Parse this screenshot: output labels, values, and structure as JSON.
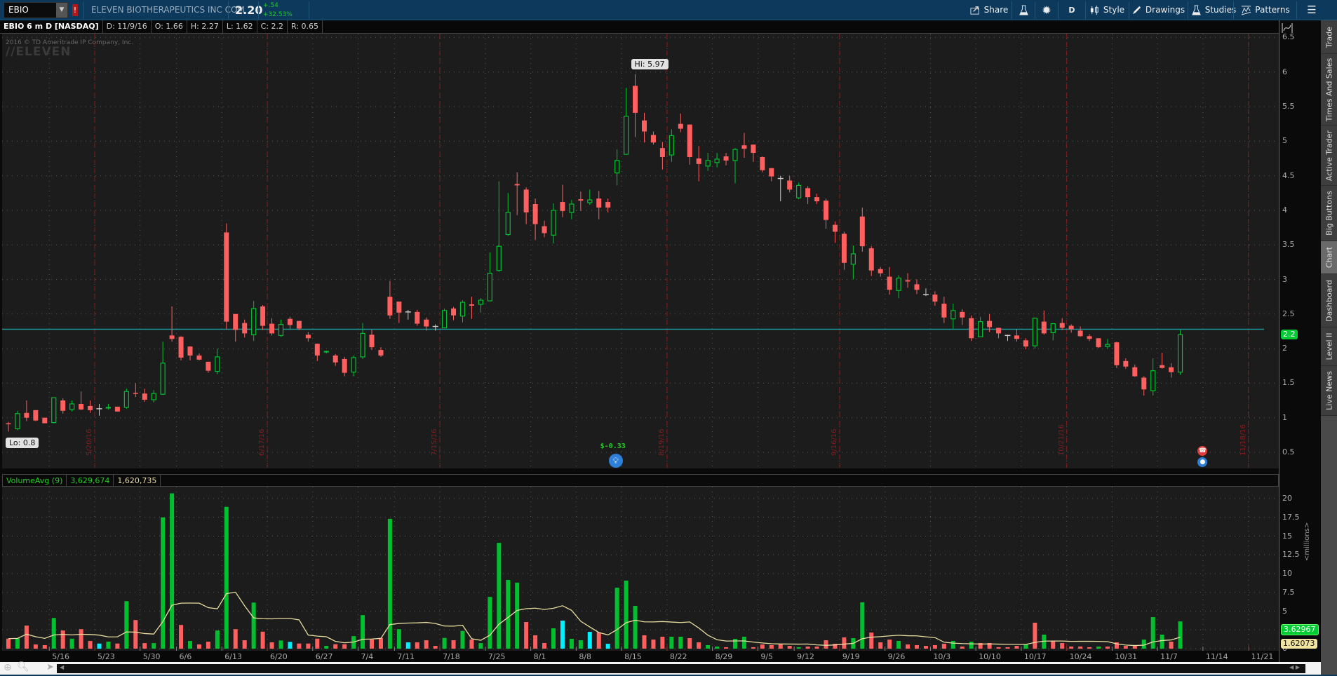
{
  "header": {
    "symbol": "EBIO",
    "alert_badge": "!",
    "company": "ELEVEN BIOTHERAPEUTICS INC COM",
    "last": "2.20",
    "change": "+.54",
    "change_pct": "+32.53%",
    "buttons": {
      "share": "Share",
      "aggregation": "D",
      "style": "Style",
      "drawings": "Drawings",
      "studies": "Studies",
      "patterns": "Patterns"
    }
  },
  "info": {
    "title": "EBIO 6 m D [NASDAQ]",
    "date": "D: 11/9/16",
    "open": "O: 1.66",
    "high": "H: 2.27",
    "low": "L: 1.62",
    "close": "C: 2.2",
    "range": "R: 0.65"
  },
  "watermark": {
    "copyright": "2016 © TD Ameritrade IP Company, Inc.",
    "logo": "ELEVEN"
  },
  "volume_header": {
    "study": "VolumeAvg (9)",
    "volume": "3,629,674",
    "avg": "1,620,735"
  },
  "side_tabs": [
    "Trade",
    "Times And Sales",
    "Active Trader",
    "Big Buttons",
    "Chart",
    "Dashboard",
    "Level II",
    "Live News"
  ],
  "active_tab": "Chart",
  "annotations": {
    "hi": "Hi: 5.97",
    "lo": "Lo: 0.8",
    "earnings": "$-0.33",
    "last_tag": "2.2",
    "vol_tag": "3.62967",
    "avg_tag": "1.62073",
    "vol_unit": "<millions>"
  },
  "colors": {
    "up": "#00c030",
    "down": "#ff5f5f",
    "neutral": "#c8c8c8",
    "cyan": "#00f0ff",
    "avg": "#e8dca0",
    "hline": "#1a9c9c",
    "event": "#8b1a1a"
  },
  "chart_data": {
    "type": "candlestick",
    "symbol": "EBIO",
    "period": "6 m",
    "aggregation": "D",
    "price_axis": {
      "ticks": [
        "0.5",
        "1",
        "1.5",
        "2",
        "2.5",
        "3",
        "3.5",
        "4",
        "4.5",
        "5",
        "5.5",
        "6",
        "6.5"
      ],
      "range": [
        0.5,
        6.5
      ]
    },
    "volume_axis": {
      "ticks": [
        "0",
        "2.5",
        "5",
        "7.5",
        "10",
        "12.5",
        "15",
        "17.5",
        "20"
      ],
      "range": [
        0,
        20
      ],
      "unit": "millions"
    },
    "horizontal_line": 2.28,
    "x_labels": [
      {
        "label": "5/16",
        "index": 5
      },
      {
        "label": "5/23",
        "index": 10
      },
      {
        "label": "5/30",
        "index": 15
      },
      {
        "label": "6/6",
        "index": 19
      },
      {
        "label": "6/13",
        "index": 24
      },
      {
        "label": "6/20",
        "index": 29
      },
      {
        "label": "6/27",
        "index": 34
      },
      {
        "label": "7/4",
        "index": 39
      },
      {
        "label": "7/11",
        "index": 43
      },
      {
        "label": "7/18",
        "index": 48
      },
      {
        "label": "7/25",
        "index": 53
      },
      {
        "label": "8/1",
        "index": 58
      },
      {
        "label": "8/8",
        "index": 63
      },
      {
        "label": "8/15",
        "index": 68
      },
      {
        "label": "8/22",
        "index": 73
      },
      {
        "label": "8/29",
        "index": 78
      },
      {
        "label": "9/5",
        "index": 83
      },
      {
        "label": "9/12",
        "index": 87
      },
      {
        "label": "9/19",
        "index": 92
      },
      {
        "label": "9/26",
        "index": 97
      },
      {
        "label": "10/3",
        "index": 102
      },
      {
        "label": "10/10",
        "index": 107
      },
      {
        "label": "10/17",
        "index": 112
      },
      {
        "label": "10/24",
        "index": 117
      },
      {
        "label": "10/31",
        "index": 122
      },
      {
        "label": "11/7",
        "index": 127
      },
      {
        "label": "11/14",
        "index": 132
      },
      {
        "label": "11/21",
        "index": 137
      }
    ],
    "events": [
      {
        "label": "5/20/16",
        "after_index": 9
      },
      {
        "label": "6/17/16",
        "after_index": 28
      },
      {
        "label": "7/15/16",
        "after_index": 47
      },
      {
        "label": "8/19/16",
        "after_index": 72
      },
      {
        "label": "9/16/16",
        "after_index": 91
      },
      {
        "label": "10/21/16",
        "after_index": 116
      },
      {
        "label": "11/18/16",
        "after_index": 136
      }
    ],
    "hi_index": 69,
    "lo_index": 0,
    "earnings_index": 67,
    "icons_index": 132,
    "ohlc": [
      [
        0.92,
        0.94,
        0.8,
        0.91
      ],
      [
        0.84,
        1.1,
        0.82,
        1.06
      ],
      [
        1.07,
        1.25,
        0.95,
        1.0
      ],
      [
        1.11,
        1.11,
        0.95,
        0.96
      ],
      [
        1.0,
        1.0,
        0.92,
        0.92
      ],
      [
        0.93,
        1.29,
        0.92,
        1.29
      ],
      [
        1.25,
        1.28,
        1.06,
        1.1
      ],
      [
        1.12,
        1.25,
        1.09,
        1.2
      ],
      [
        1.2,
        1.38,
        1.11,
        1.12
      ],
      [
        1.17,
        1.25,
        1.07,
        1.11
      ],
      [
        1.13,
        1.2,
        1.03,
        1.13
      ],
      [
        1.14,
        1.2,
        1.12,
        1.15
      ],
      [
        1.16,
        1.16,
        1.09,
        1.09
      ],
      [
        1.15,
        1.42,
        1.13,
        1.38
      ],
      [
        1.36,
        1.5,
        1.3,
        1.35
      ],
      [
        1.35,
        1.42,
        1.23,
        1.26
      ],
      [
        1.26,
        1.4,
        1.22,
        1.35
      ],
      [
        1.34,
        2.1,
        1.34,
        1.79
      ],
      [
        2.19,
        2.61,
        2.1,
        2.14
      ],
      [
        2.17,
        2.18,
        1.83,
        1.87
      ],
      [
        2.03,
        2.03,
        1.83,
        1.9
      ],
      [
        1.9,
        1.93,
        1.83,
        1.84
      ],
      [
        1.81,
        1.81,
        1.65,
        1.68
      ],
      [
        1.67,
        2.0,
        1.63,
        1.88
      ],
      [
        3.68,
        3.81,
        2.28,
        2.39
      ],
      [
        2.5,
        2.5,
        2.1,
        2.27
      ],
      [
        2.37,
        2.42,
        2.16,
        2.22
      ],
      [
        2.2,
        2.69,
        2.11,
        2.58
      ],
      [
        2.61,
        2.63,
        2.27,
        2.33
      ],
      [
        2.36,
        2.44,
        2.19,
        2.22
      ],
      [
        2.19,
        2.42,
        2.17,
        2.35
      ],
      [
        2.43,
        2.46,
        2.28,
        2.34
      ],
      [
        2.4,
        2.4,
        2.27,
        2.29
      ],
      [
        2.2,
        2.24,
        2.1,
        2.15
      ],
      [
        2.07,
        2.07,
        1.82,
        1.9
      ],
      [
        1.95,
        1.97,
        1.93,
        1.96
      ],
      [
        1.9,
        1.92,
        1.75,
        1.8
      ],
      [
        1.85,
        1.88,
        1.6,
        1.65
      ],
      [
        1.66,
        1.9,
        1.6,
        1.87
      ],
      [
        1.88,
        2.37,
        1.85,
        2.22
      ],
      [
        2.2,
        2.27,
        1.98,
        2.02
      ],
      [
        1.98,
        2.02,
        1.88,
        1.9
      ],
      [
        2.75,
        2.98,
        2.43,
        2.48
      ],
      [
        2.68,
        2.68,
        2.37,
        2.52
      ],
      [
        2.53,
        2.56,
        2.42,
        2.53
      ],
      [
        2.53,
        2.56,
        2.33,
        2.36
      ],
      [
        2.42,
        2.45,
        2.26,
        2.32
      ],
      [
        2.32,
        2.35,
        2.26,
        2.32
      ],
      [
        2.3,
        2.58,
        2.3,
        2.55
      ],
      [
        2.58,
        2.6,
        2.41,
        2.48
      ],
      [
        2.47,
        2.7,
        2.38,
        2.67
      ],
      [
        2.64,
        2.75,
        2.43,
        2.62
      ],
      [
        2.64,
        2.73,
        2.52,
        2.7
      ],
      [
        2.69,
        3.39,
        2.69,
        3.09
      ],
      [
        3.13,
        4.42,
        3.11,
        3.48
      ],
      [
        3.65,
        4.25,
        3.63,
        3.97
      ],
      [
        4.38,
        4.55,
        3.93,
        4.36
      ],
      [
        4.3,
        4.33,
        3.8,
        3.97
      ],
      [
        4.09,
        4.17,
        3.57,
        3.8
      ],
      [
        3.77,
        3.85,
        3.61,
        3.67
      ],
      [
        3.64,
        4.1,
        3.52,
        4.0
      ],
      [
        4.12,
        4.37,
        3.9,
        3.99
      ],
      [
        3.97,
        4.15,
        3.87,
        4.09
      ],
      [
        4.16,
        4.27,
        3.99,
        4.14
      ],
      [
        4.11,
        4.3,
        4.08,
        4.15
      ],
      [
        4.17,
        4.28,
        3.87,
        4.04
      ],
      [
        4.12,
        4.17,
        3.97,
        4.04
      ],
      [
        4.54,
        4.88,
        4.36,
        4.72
      ],
      [
        4.81,
        5.77,
        4.8,
        5.36
      ],
      [
        5.8,
        5.97,
        5.06,
        5.41
      ],
      [
        5.3,
        5.41,
        4.98,
        5.14
      ],
      [
        5.09,
        5.14,
        4.95,
        4.98
      ],
      [
        4.9,
        4.99,
        4.59,
        4.77
      ],
      [
        4.8,
        5.17,
        4.7,
        5.08
      ],
      [
        5.25,
        5.4,
        5.13,
        5.18
      ],
      [
        5.24,
        5.24,
        4.66,
        4.77
      ],
      [
        4.75,
        4.93,
        4.42,
        4.67
      ],
      [
        4.64,
        4.83,
        4.57,
        4.72
      ],
      [
        4.69,
        4.83,
        4.62,
        4.74
      ],
      [
        4.78,
        4.83,
        4.65,
        4.72
      ],
      [
        4.72,
        4.9,
        4.39,
        4.88
      ],
      [
        4.94,
        5.12,
        4.76,
        4.89
      ],
      [
        4.95,
        4.95,
        4.7,
        4.83
      ],
      [
        4.77,
        4.78,
        4.55,
        4.58
      ],
      [
        4.61,
        4.61,
        4.42,
        4.49
      ],
      [
        4.46,
        4.5,
        4.13,
        4.46
      ],
      [
        4.43,
        4.5,
        4.26,
        4.3
      ],
      [
        4.18,
        4.4,
        4.16,
        4.36
      ],
      [
        4.32,
        4.35,
        4.09,
        4.19
      ],
      [
        4.19,
        4.24,
        4.09,
        4.13
      ],
      [
        4.14,
        4.17,
        3.73,
        3.86
      ],
      [
        3.79,
        3.84,
        3.53,
        3.69
      ],
      [
        3.66,
        3.69,
        3.14,
        3.24
      ],
      [
        3.22,
        3.49,
        3.0,
        3.37
      ],
      [
        3.91,
        4.04,
        3.4,
        3.48
      ],
      [
        3.45,
        3.48,
        3.05,
        3.13
      ],
      [
        3.15,
        3.18,
        3.04,
        3.09
      ],
      [
        3.04,
        3.18,
        2.78,
        2.85
      ],
      [
        2.84,
        3.06,
        2.73,
        3.02
      ],
      [
        2.99,
        3.09,
        2.88,
        2.97
      ],
      [
        2.93,
        3.0,
        2.79,
        2.85
      ],
      [
        2.78,
        2.87,
        2.76,
        2.78
      ],
      [
        2.78,
        2.83,
        2.62,
        2.68
      ],
      [
        2.65,
        2.75,
        2.37,
        2.45
      ],
      [
        2.43,
        2.65,
        2.29,
        2.55
      ],
      [
        2.53,
        2.57,
        2.34,
        2.45
      ],
      [
        2.44,
        2.48,
        2.11,
        2.15
      ],
      [
        2.17,
        2.46,
        2.17,
        2.39
      ],
      [
        2.4,
        2.5,
        2.24,
        2.31
      ],
      [
        2.3,
        2.3,
        2.15,
        2.22
      ],
      [
        2.19,
        2.2,
        2.11,
        2.19
      ],
      [
        2.19,
        2.28,
        2.1,
        2.14
      ],
      [
        2.12,
        2.15,
        1.99,
        2.03
      ],
      [
        2.04,
        2.45,
        2.0,
        2.44
      ],
      [
        2.39,
        2.55,
        2.2,
        2.22
      ],
      [
        2.23,
        2.37,
        2.12,
        2.36
      ],
      [
        2.37,
        2.44,
        2.27,
        2.3
      ],
      [
        2.33,
        2.35,
        2.23,
        2.28
      ],
      [
        2.26,
        2.32,
        2.17,
        2.18
      ],
      [
        2.18,
        2.21,
        2.11,
        2.14
      ],
      [
        2.15,
        2.15,
        2.01,
        2.02
      ],
      [
        2.03,
        2.14,
        2.0,
        2.06
      ],
      [
        2.09,
        2.1,
        1.72,
        1.76
      ],
      [
        1.82,
        1.86,
        1.71,
        1.74
      ],
      [
        1.73,
        1.77,
        1.59,
        1.6
      ],
      [
        1.58,
        1.6,
        1.32,
        1.41
      ],
      [
        1.39,
        1.86,
        1.32,
        1.68
      ],
      [
        1.76,
        1.94,
        1.71,
        1.72
      ],
      [
        1.73,
        1.79,
        1.58,
        1.66
      ],
      [
        1.66,
        2.27,
        1.62,
        2.2
      ]
    ],
    "volume_millions": [
      1.33,
      1.4,
      3.07,
      0.56,
      0.47,
      4.09,
      2.42,
      1.33,
      2.6,
      1.02,
      0.68,
      0.93,
      0.68,
      6.33,
      3.81,
      0.74,
      0.74,
      17.5,
      20.7,
      3.16,
      1.02,
      0.56,
      0.93,
      2.42,
      18.9,
      2.6,
      1.12,
      6.14,
      2.26,
      0.84,
      1.09,
      0.9,
      0.68,
      0.68,
      1.33,
      0.37,
      0.59,
      0.59,
      1.67,
      4.47,
      1.21,
      1.43,
      17.3,
      2.6,
      0.84,
      0.84,
      1.12,
      0.37,
      1.43,
      1.12,
      2.36,
      1.21,
      0.74,
      6.9,
      14.1,
      9.16,
      8.8,
      3.55,
      1.78,
      0.75,
      2.71,
      3.74,
      1.31,
      1.12,
      2.24,
      2.18,
      0.65,
      8.13,
      9.07,
      5.7,
      1.78,
      1.21,
      1.59,
      1.59,
      1.59,
      1.4,
      0.84,
      0.47,
      0.28,
      0.19,
      1.31,
      1.59,
      0.19,
      0.56,
      0.47,
      0.56,
      0.37,
      0.19,
      0.28,
      0.28,
      1.12,
      0.65,
      1.5,
      1.4,
      6.17,
      2.15,
      0.84,
      1.21,
      1.03,
      0.56,
      0.47,
      0.37,
      0.47,
      0.65,
      1.03,
      0.28,
      0.93,
      0.75,
      0.75,
      0.19,
      0.19,
      0.37,
      0.56,
      3.46,
      1.87,
      1.03,
      0.75,
      0.28,
      0.28,
      0.19,
      0.28,
      0.28,
      0.84,
      0.37,
      0.47,
      1.21,
      4.2,
      1.87,
      0.93,
      3.63
    ],
    "volume_colors": "rgrrrgrgrrcgrgrrgggrgrrggrrgrrgcrrrgrrggrrggcrrrgrgrgggggrrrgcggcrcgggrrrggrrggrggrrrrrgrrrrrggrrrgrrrrrgrgrrrrrgrgrrrrrgrrrrgggrg",
    "volume_avg_period": 9
  }
}
